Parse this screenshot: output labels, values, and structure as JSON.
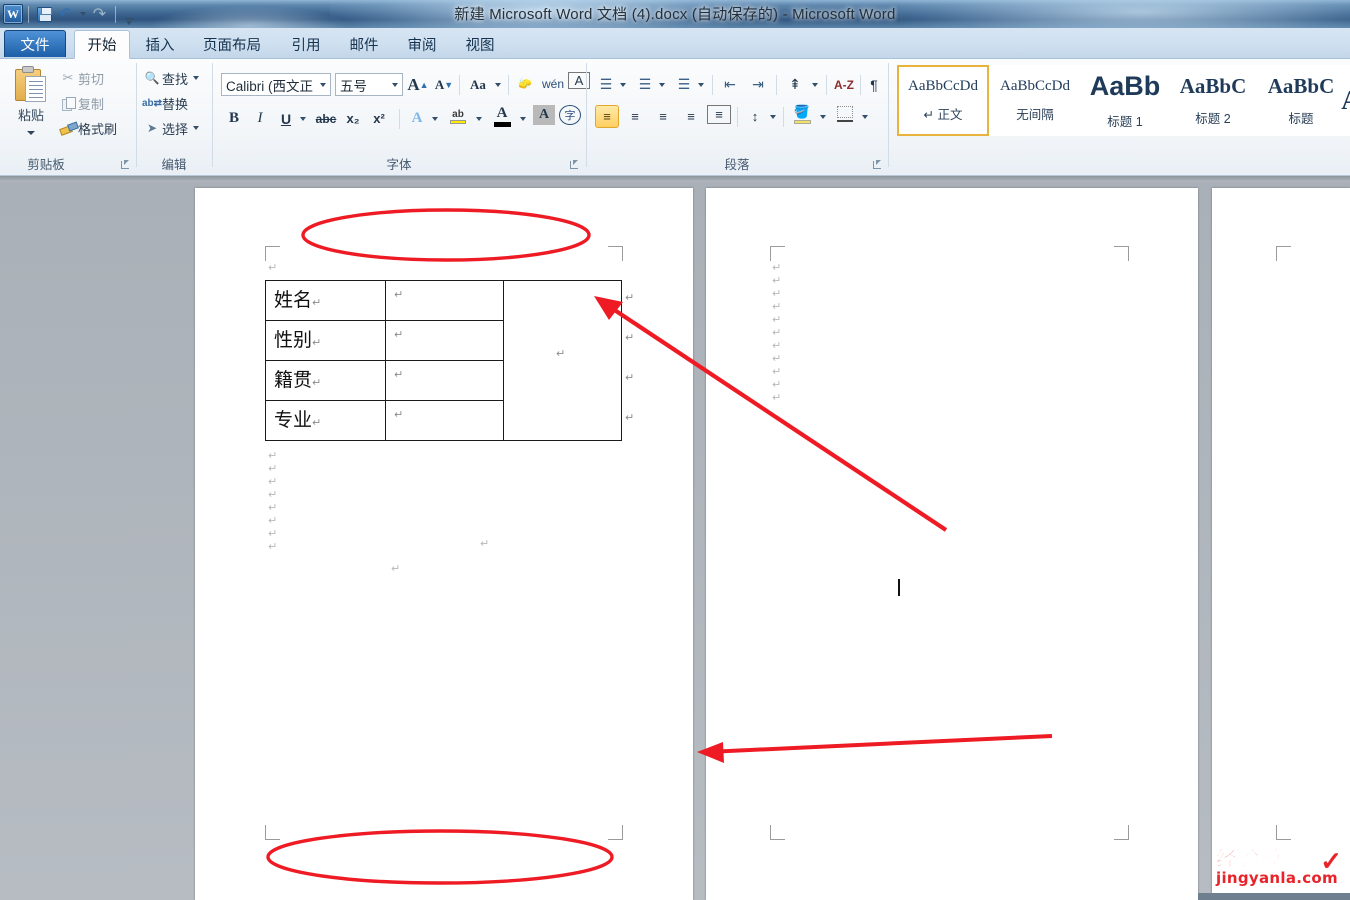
{
  "window": {
    "title": "新建 Microsoft Word 文档 (4).docx (自动保存的)  -  Microsoft Word",
    "app_logo": "W"
  },
  "quick_access": {
    "save": "save-icon",
    "undo": "↺",
    "redo": "↻",
    "customize": "customize-qat-icon"
  },
  "tabs": [
    {
      "label": "文件",
      "type": "file"
    },
    {
      "label": "开始",
      "type": "active"
    },
    {
      "label": "插入",
      "type": "normal"
    },
    {
      "label": "页面布局",
      "type": "normal"
    },
    {
      "label": "引用",
      "type": "normal"
    },
    {
      "label": "邮件",
      "type": "normal"
    },
    {
      "label": "审阅",
      "type": "normal"
    },
    {
      "label": "视图",
      "type": "normal"
    }
  ],
  "ribbon": {
    "clipboard": {
      "group_label": "剪贴板",
      "paste": "粘贴",
      "cut": "剪切",
      "copy": "复制",
      "format_painter": "格式刷"
    },
    "editing": {
      "group_label": "编辑",
      "find": "查找",
      "replace": "替换",
      "select": "选择"
    },
    "font": {
      "group_label": "字体",
      "font_name": "Calibri (西文正",
      "font_size": "五号",
      "grow_font": "A",
      "shrink_font": "A",
      "change_case": "Aa",
      "clear_formatting": "clear-format-icon",
      "phonetic_guide": "wén",
      "character_border": "A",
      "bold": "B",
      "italic": "I",
      "underline": "U",
      "strikethrough": "abc",
      "subscript": "x₂",
      "superscript": "x²",
      "text_effects": "A",
      "highlight": "ab",
      "font_color": "A",
      "shading_char": "A",
      "enclose_char": "字"
    },
    "paragraph": {
      "group_label": "段落",
      "bullets": "bullets-icon",
      "numbering": "numbering-icon",
      "multilevel": "multilevel-list-icon",
      "decrease_indent": "decrease-indent-icon",
      "increase_indent": "increase-indent-icon",
      "sort": "sort-icon",
      "sort_az": "A-Z",
      "show_marks": "show-formatting-marks-icon",
      "align_left": "align-left-icon",
      "align_center": "align-center-icon",
      "align_right": "align-right-icon",
      "justify": "justify-icon",
      "distribute": "distribute-icon",
      "line_spacing": "line-spacing-icon",
      "shading": "shading-icon",
      "borders": "borders-icon"
    },
    "styles": [
      {
        "preview": "AaBbCcDd",
        "name": "↵ 正文",
        "size": 15,
        "serif": false,
        "active": true
      },
      {
        "preview": "AaBbCcDd",
        "name": "无间隔",
        "size": 15,
        "serif": false,
        "active": false
      },
      {
        "preview": "AaBb",
        "name": "标题 1",
        "size": 26,
        "serif": false,
        "active": false
      },
      {
        "preview": "AaBbC",
        "name": "标题 2",
        "size": 21,
        "serif": true,
        "active": false
      },
      {
        "preview": "AaBbC",
        "name": "标题",
        "size": 21,
        "serif": true,
        "active": false
      },
      {
        "preview": "A",
        "name": "",
        "size": 26,
        "serif": true,
        "active": false
      }
    ]
  },
  "document": {
    "table": {
      "rows": [
        {
          "label": "姓名",
          "value": ""
        },
        {
          "label": "性别",
          "value": ""
        },
        {
          "label": "籍贯",
          "value": ""
        },
        {
          "label": "专业",
          "value": ""
        }
      ],
      "photo_cell": ""
    },
    "paragraph_mark": "↵",
    "pilcrow": "↵",
    "pages": 3
  },
  "annotations": {
    "color": "#ee1b24",
    "top_ellipse": "top-margin-highlight",
    "bottom_ellipse": "bottom-margin-highlight",
    "arrow1": "arrow-pointing-to-table-right-edge",
    "arrow2": "arrow-pointing-to-page-gap"
  },
  "watermark": {
    "line1": "经验啦",
    "line2": "jingyanla.com",
    "check": "✓",
    "color": "#e8232a"
  }
}
